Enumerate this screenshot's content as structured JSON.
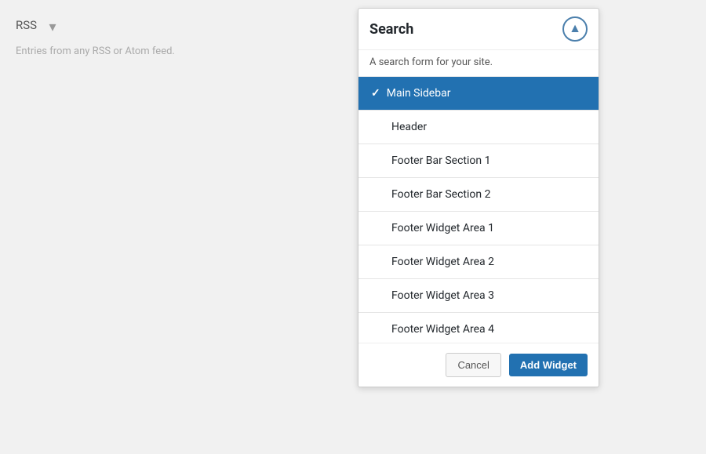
{
  "left_panel": {
    "widget_name": "RSS",
    "widget_description": "Entries from any RSS or Atom feed."
  },
  "modal": {
    "title": "Search",
    "subtitle": "A search form for your site.",
    "toggle_icon": "▲",
    "items": [
      {
        "label": "Main Sidebar",
        "selected": true
      },
      {
        "label": "Header",
        "selected": false
      },
      {
        "label": "Footer Bar Section 1",
        "selected": false
      },
      {
        "label": "Footer Bar Section 2",
        "selected": false
      },
      {
        "label": "Footer Widget Area 1",
        "selected": false
      },
      {
        "label": "Footer Widget Area 2",
        "selected": false
      },
      {
        "label": "Footer Widget Area 3",
        "selected": false
      },
      {
        "label": "Footer Widget Area 4",
        "selected": false
      }
    ],
    "cancel_label": "Cancel",
    "add_label": "Add Widget"
  }
}
